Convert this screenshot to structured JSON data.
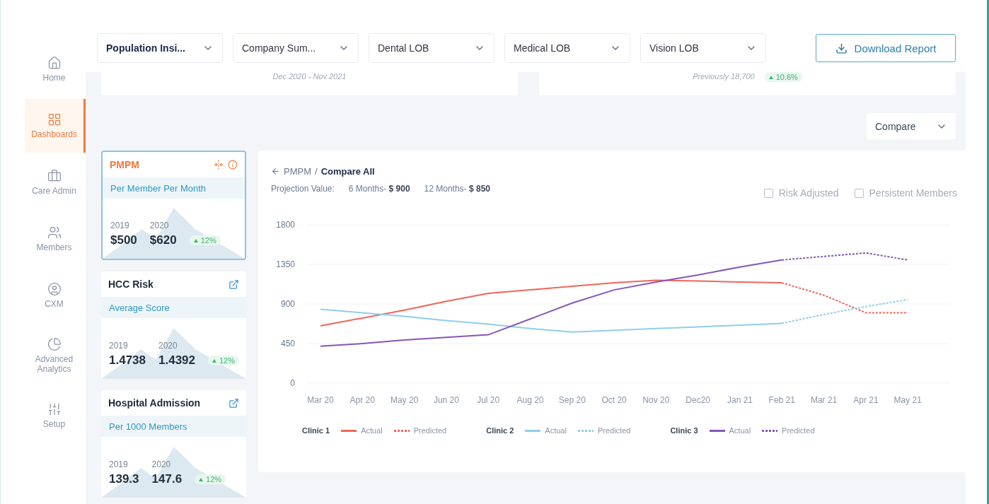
{
  "sidebar": {
    "items": [
      {
        "label": "Home",
        "selected": false
      },
      {
        "label": "Dashboards",
        "selected": true
      },
      {
        "label": "Care Admin",
        "selected": false
      },
      {
        "label": "Members",
        "selected": false
      },
      {
        "label": "CXM",
        "selected": false
      },
      {
        "label": "Advanced Analytics",
        "selected": false
      },
      {
        "label": "Setup",
        "selected": false
      }
    ]
  },
  "filters": [
    {
      "label": "Population Insi...",
      "selected": true
    },
    {
      "label": "Company Sum...",
      "selected": false
    },
    {
      "label": "Dental LOB",
      "selected": false
    },
    {
      "label": "Medical LOB",
      "selected": false
    },
    {
      "label": "Vision LOB",
      "selected": false
    }
  ],
  "download_button": "Download Report",
  "summary_cards": [
    {
      "note": "Dec 2020 - Nov 2021"
    },
    {
      "note": "Previously 18,700",
      "badge": "10.6%"
    }
  ],
  "compare_dropdown": "Compare",
  "metric_cards": [
    {
      "title": "PMPM",
      "subtitle": "Per Member Per Month",
      "year_1": "2019",
      "value_1": "$500",
      "year_2": "2020",
      "value_2": "$620",
      "change": "12%",
      "selected": true
    },
    {
      "title": "HCC Risk",
      "subtitle": "Average Score",
      "year_1": "2019",
      "value_1": "1.4738",
      "year_2": "2020",
      "value_2": "1.4392",
      "change": "12%",
      "selected": false
    },
    {
      "title": "Hospital Admission",
      "subtitle": "Per 1000 Members",
      "year_1": "2019",
      "value_1": "139.3",
      "year_2": "2020",
      "value_2": "147.6",
      "change": "12%",
      "selected": false
    }
  ],
  "chart_panel": {
    "breadcrumb": {
      "parent": "PMPM",
      "separator": "/",
      "current": "Compare All"
    },
    "projection_label": "Projection Value:",
    "projections": [
      {
        "period": "6 Months-",
        "value": "$ 900"
      },
      {
        "period": "12 Months-",
        "value": "$ 850"
      }
    ],
    "options": [
      {
        "label": "Risk Adjusted",
        "checked": false
      },
      {
        "label": "Persistent Members",
        "checked": false
      }
    ],
    "legend_groups": [
      "Clinic 1",
      "Clinic 2",
      "Clinic 3"
    ],
    "chart_data": {
      "type": "line",
      "grid": true,
      "categories": [
        "Mar 20",
        "Apr 20",
        "May 20",
        "Jun 20",
        "Jul 20",
        "Aug 20",
        "Sep 20",
        "Oct 20",
        "Nov 20",
        "Dec20",
        "Jan 21",
        "Feb 21",
        "Mar 21",
        "Apr 21",
        "May 21"
      ],
      "ylim": [
        0,
        1800
      ],
      "yticks": [
        0,
        450,
        900,
        1350,
        1800
      ],
      "series": [
        {
          "name": "Actual",
          "color": "#f0655a",
          "line_style": "solid",
          "values": [
            650,
            740,
            830,
            930,
            1020,
            1060,
            1100,
            1140,
            1170,
            1160,
            1150,
            1140,
            null,
            null,
            null
          ]
        },
        {
          "name": "Predicted",
          "color": "#f0655a",
          "line_style": "dashed",
          "values": [
            null,
            null,
            null,
            null,
            null,
            null,
            null,
            null,
            null,
            null,
            null,
            1140,
            1000,
            800,
            800
          ]
        },
        {
          "name": "Actual",
          "color": "#8fcdf0",
          "line_style": "solid",
          "values": [
            840,
            800,
            760,
            710,
            670,
            620,
            580,
            600,
            620,
            640,
            660,
            680,
            null,
            null,
            null
          ]
        },
        {
          "name": "Predicted",
          "color": "#8fcdf0",
          "line_style": "dashed",
          "values": [
            null,
            null,
            null,
            null,
            null,
            null,
            null,
            null,
            null,
            null,
            null,
            680,
            780,
            870,
            950
          ]
        },
        {
          "name": "Actual",
          "color": "#8656b8",
          "line_style": "solid",
          "values": [
            420,
            450,
            490,
            520,
            550,
            730,
            910,
            1060,
            1150,
            1230,
            1320,
            1400,
            null,
            null,
            null
          ]
        },
        {
          "name": "Predicted",
          "color": "#8656b8",
          "line_style": "dashed",
          "values": [
            null,
            null,
            null,
            null,
            null,
            null,
            null,
            null,
            null,
            null,
            null,
            1400,
            1440,
            1480,
            1400
          ]
        }
      ]
    }
  }
}
